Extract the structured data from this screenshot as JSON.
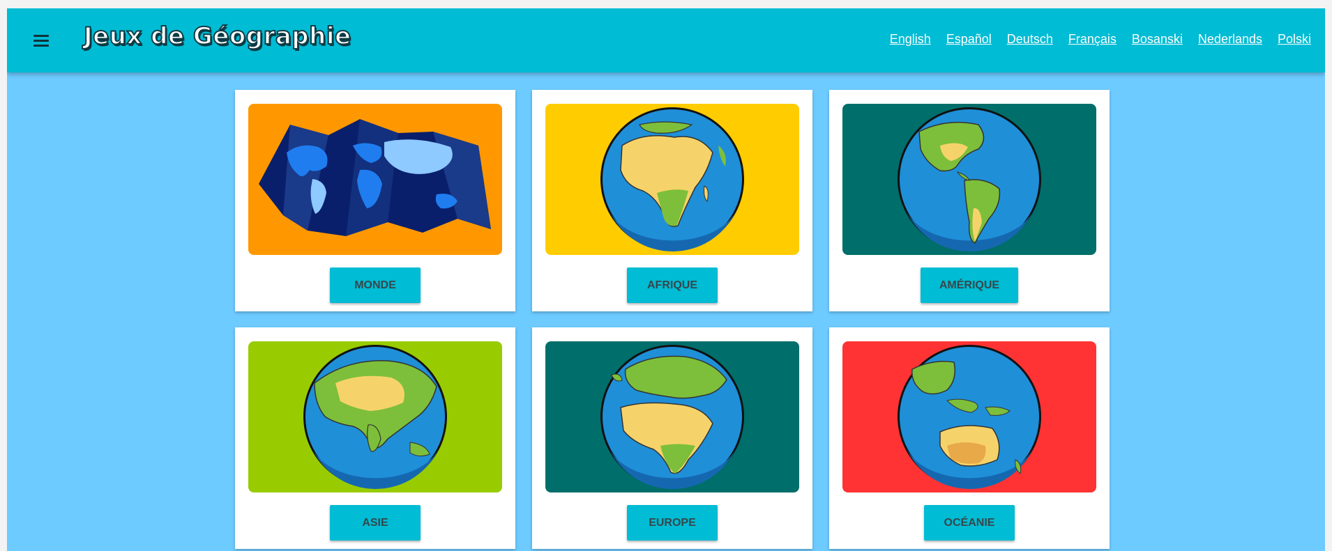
{
  "header": {
    "title": "Jeux de Géographie",
    "languages": [
      "English",
      "Español",
      "Deutsch",
      "Français",
      "Bosanski",
      "Nederlands",
      "Polski"
    ]
  },
  "cards": [
    {
      "label": "MONDE",
      "bg": "#ff9800",
      "image": "world-map-icon"
    },
    {
      "label": "AFRIQUE",
      "bg": "#ffcc00",
      "image": "globe-africa-icon"
    },
    {
      "label": "AMÉRIQUE",
      "bg": "#006e6a",
      "image": "globe-america-icon"
    },
    {
      "label": "ASIE",
      "bg": "#99cc00",
      "image": "globe-asia-icon"
    },
    {
      "label": "EUROPE",
      "bg": "#006e6a",
      "image": "globe-europe-icon"
    },
    {
      "label": "OCÉANIE",
      "bg": "#ff3333",
      "image": "globe-oceania-icon"
    }
  ],
  "colors": {
    "page_bg": "#6ecbff",
    "header_bg": "#00bcd4",
    "button_bg": "#00bcd4",
    "ocean": "#1f8fd8",
    "land_green": "#7dbf3a",
    "land_sand": "#f6d36a"
  }
}
